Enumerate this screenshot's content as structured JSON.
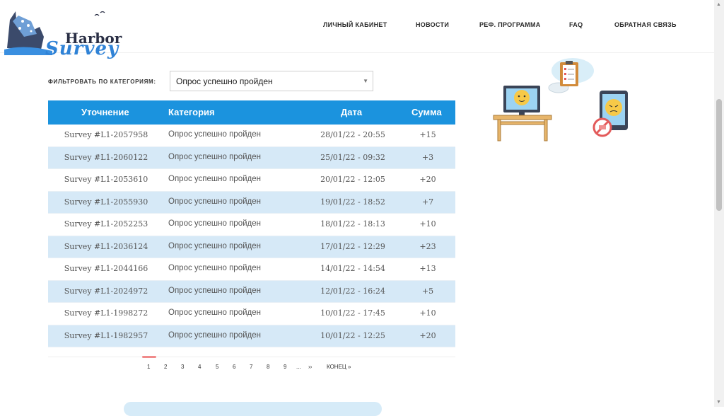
{
  "logo": {
    "line1": "Harbor",
    "line2": "Survey"
  },
  "nav": {
    "account": "ЛИЧНЫЙ КАБИНЕТ",
    "news": "НОВОСТИ",
    "referral": "РЕФ. ПРОГРАММА",
    "faq": "FAQ",
    "feedback": "ОБРАТНАЯ СВЯЗЬ"
  },
  "filter": {
    "label": "ФИЛЬТРОВАТЬ ПО КАТЕГОРИЯМ:",
    "selected": "Опрос успешно пройден"
  },
  "table": {
    "headers": {
      "id": "Уточнение",
      "category": "Категория",
      "date": "Дата",
      "sum": "Сумма"
    },
    "rows": [
      {
        "id": "Survey #L1-2057958",
        "category": "Опрос успешно пройден",
        "date": "28/01/22 - 20:55",
        "sum": "+15"
      },
      {
        "id": "Survey #L1-2060122",
        "category": "Опрос успешно пройден",
        "date": "25/01/22 - 09:32",
        "sum": "+3"
      },
      {
        "id": "Survey #L1-2053610",
        "category": "Опрос успешно пройден",
        "date": "20/01/22 - 12:05",
        "sum": "+20"
      },
      {
        "id": "Survey #L1-2055930",
        "category": "Опрос успешно пройден",
        "date": "19/01/22 - 18:52",
        "sum": "+7"
      },
      {
        "id": "Survey #L1-2052253",
        "category": "Опрос успешно пройден",
        "date": "18/01/22 - 18:13",
        "sum": "+10"
      },
      {
        "id": "Survey #L1-2036124",
        "category": "Опрос успешно пройден",
        "date": "17/01/22 - 12:29",
        "sum": "+23"
      },
      {
        "id": "Survey #L1-2044166",
        "category": "Опрос успешно пройден",
        "date": "14/01/22 - 14:54",
        "sum": "+13"
      },
      {
        "id": "Survey #L1-2024972",
        "category": "Опрос успешно пройден",
        "date": "12/01/22 - 16:24",
        "sum": "+5"
      },
      {
        "id": "Survey #L1-1998272",
        "category": "Опрос успешно пройден",
        "date": "10/01/22 - 17:45",
        "sum": "+10"
      },
      {
        "id": "Survey #L1-1982957",
        "category": "Опрос успешно пройден",
        "date": "10/01/22 - 12:25",
        "sum": "+20"
      }
    ]
  },
  "pagination": {
    "pages": [
      "1",
      "2",
      "3",
      "4",
      "5",
      "6",
      "7",
      "8",
      "9"
    ],
    "ellipsis": "...",
    "next": "››",
    "last": "КОНЕЦ »",
    "current": "1"
  },
  "colors": {
    "header_blue": "#1b93de",
    "row_alt": "#d6e9f7",
    "accent_red": "#f08a8a"
  }
}
